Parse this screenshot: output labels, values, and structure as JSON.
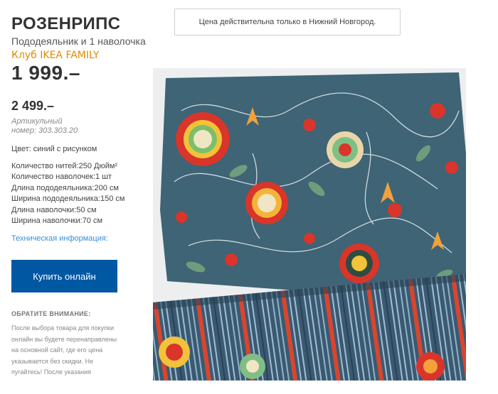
{
  "product": {
    "name": "РОЗЕНРИПС",
    "subtitle": "Пододеяльник и 1 наволочка",
    "family_label": "Клуб IKEA FAMILY",
    "family_price": "1 999.–",
    "regular_price": "2 499.–",
    "article_label": "Артикульный",
    "article_number": "номер: 303.303.20",
    "color": "Цвет: синий с рисунком"
  },
  "specs": [
    "Количество нитей:250 Дюйм²",
    "Количество наволочек:1 шт",
    "Длина пододеяльника:200 см",
    "Ширина пододеяльника:150 см",
    "Длина наволочки:50 см",
    "Ширина наволочки:70 см"
  ],
  "tech_info_link": "Техническая информация:",
  "buy_button": "Купить онлайн",
  "notice": {
    "title": "ОБРАТИТЕ ВНИМАНИЕ:",
    "text": "После выбора товара для покупки онлайн вы будете перенаправлены на основной сайт, где его цена указывается без скидки. Не пугайтесь! После указания"
  },
  "city_notice": "Цена действительна только в Нижний Новгород.",
  "colors": {
    "brand_blue": "#0058a3",
    "family_orange": "#e08a00",
    "link_blue": "#3a8fd6",
    "fabric_base": "#3e6475"
  }
}
